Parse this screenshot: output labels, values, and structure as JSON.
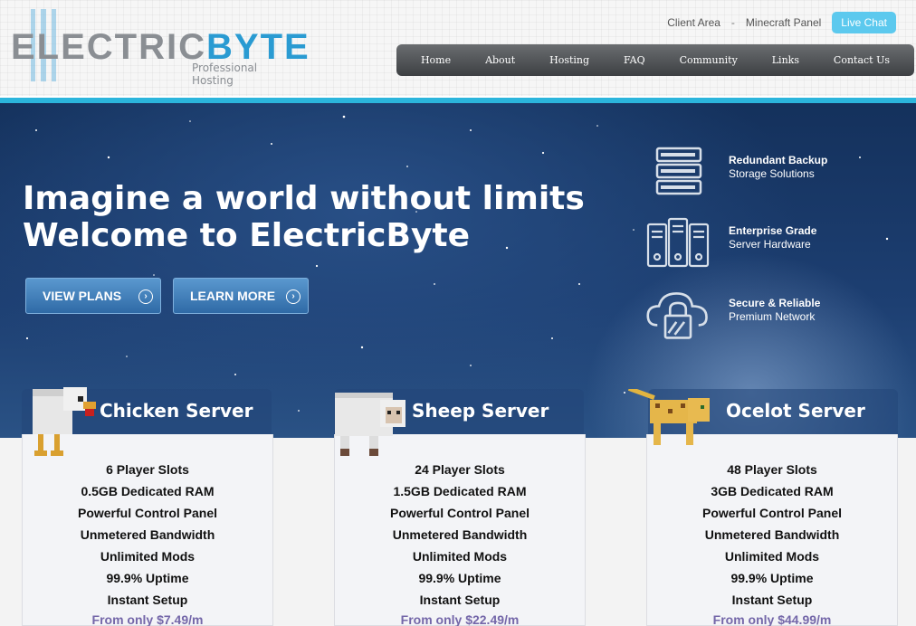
{
  "brand": {
    "logo_main": "ELECTRIC",
    "logo_accent": "BYTE",
    "tagline": "Professional Hosting"
  },
  "toplinks": {
    "client_area": "Client Area",
    "separator": "-",
    "minecraft_panel": "Minecraft Panel",
    "live_chat": "Live Chat"
  },
  "nav": {
    "items": [
      "Home",
      "About",
      "Hosting",
      "FAQ",
      "Community",
      "Links",
      "Contact Us"
    ]
  },
  "hero": {
    "title_line1": "Imagine a world without limits",
    "title_line2": "Welcome to ElectricByte",
    "buttons": [
      "VIEW PLANS",
      "LEARN MORE"
    ]
  },
  "features": [
    {
      "title": "Redundant Backup",
      "subtitle": "Storage Solutions",
      "icon": "server-rack-icon"
    },
    {
      "title": "Enterprise Grade",
      "subtitle": "Server Hardware",
      "icon": "tower-servers-icon"
    },
    {
      "title": "Secure & Reliable",
      "subtitle": "Premium Network",
      "icon": "cloud-lock-icon"
    }
  ],
  "plans": [
    {
      "name": "Chicken Server",
      "mob": "chicken",
      "features": [
        "6 Player Slots",
        "0.5GB Dedicated RAM",
        "Powerful Control Panel",
        "Unmetered Bandwidth",
        "Unlimited Mods",
        "99.9% Uptime",
        "Instant Setup"
      ],
      "price": "From only $7.49/m"
    },
    {
      "name": "Sheep Server",
      "mob": "sheep",
      "features": [
        "24 Player Slots",
        "1.5GB Dedicated RAM",
        "Powerful Control Panel",
        "Unmetered Bandwidth",
        "Unlimited Mods",
        "99.9% Uptime",
        "Instant Setup"
      ],
      "price": "From only $22.49/m"
    },
    {
      "name": "Ocelot Server",
      "mob": "ocelot",
      "features": [
        "48 Player Slots",
        "3GB Dedicated RAM",
        "Powerful Control Panel",
        "Unmetered Bandwidth",
        "Unlimited Mods",
        "99.9% Uptime",
        "Instant Setup"
      ],
      "price": "From only $44.99/m"
    }
  ],
  "colors": {
    "accent": "#2bb5dc",
    "price": "#7467a9",
    "nav_bg": "#4a4d50"
  }
}
